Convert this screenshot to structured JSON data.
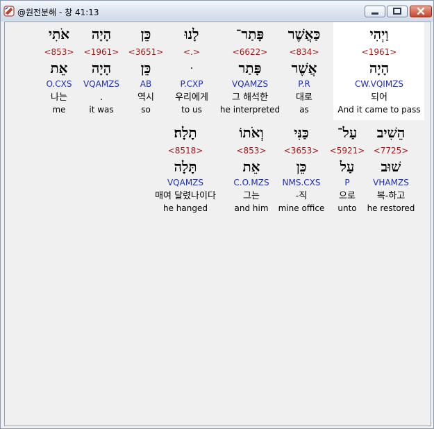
{
  "window": {
    "title": "@원전분해 - 창 41:13",
    "icon": "app-logo-icon",
    "buttons": {
      "minimize": "minimize-icon",
      "maximize": "maximize-icon",
      "close": "close-icon"
    }
  },
  "colors": {
    "strong": "#9a1818",
    "parse": "#1f2fa8",
    "highlight": "#ffffff"
  },
  "rows": [
    {
      "words": [
        {
          "word": "וַיְהִי",
          "strong": "<1961>",
          "lemma": "הָיָה",
          "parse": "CW.VQIMZS",
          "korean": "되어",
          "english": "And it came to pass"
        },
        {
          "word": "כַּאֲשֶׁר",
          "strong": "<834>",
          "lemma": "אֲשֶׁר",
          "parse": "P.R",
          "korean": "대로",
          "english": "as"
        },
        {
          "word": "פָּתַר־",
          "strong": "<6622>",
          "lemma": "פָּתַר",
          "parse": "VQAMZS",
          "korean": "그 해석한",
          "english": "he interpreted"
        },
        {
          "word": "לָנוּ",
          "strong": "<.>",
          "lemma": "ּ",
          "parse": "P.CXP",
          "korean": "우리에게",
          "english": "to us"
        },
        {
          "word": "כֵּן",
          "strong": "<3651>",
          "lemma": "כֵּן",
          "parse": "AB",
          "korean": "역시",
          "english": "so"
        },
        {
          "word": "הָיָה",
          "strong": "<1961>",
          "lemma": "הָיָה",
          "parse": "VQAMZS",
          "korean": ".",
          "english": "it was"
        },
        {
          "word": "אֹתִי",
          "strong": "<853>",
          "lemma": "אֵת",
          "parse": "O.CXS",
          "korean": "나는",
          "english": "me"
        }
      ]
    },
    {
      "words": [
        {
          "word": "הֵשִׁיב",
          "strong": "<7725>",
          "lemma": "שׁוּב",
          "parse": "VHAMZS",
          "korean": "복-하고",
          "english": "he restored"
        },
        {
          "word": "עַל־",
          "strong": "<5921>",
          "lemma": "עַל",
          "parse": "P",
          "korean": "으로",
          "english": "unto"
        },
        {
          "word": "כַּנִּי",
          "strong": "<3653>",
          "lemma": "כֵּן",
          "parse": "NMS.CXS",
          "korean": "-직",
          "english": "mine office"
        },
        {
          "word": "וְאֹתוֹ",
          "strong": "<853>",
          "lemma": "אֵת",
          "parse": "C.O.MZS",
          "korean": "그는",
          "english": "and him"
        },
        {
          "word": "תָלָה׃",
          "strong": "<8518>",
          "lemma": "תָּלָה",
          "parse": "VQAMZS",
          "korean": "매여 달렸나이다",
          "english": "he hanged"
        }
      ]
    }
  ]
}
